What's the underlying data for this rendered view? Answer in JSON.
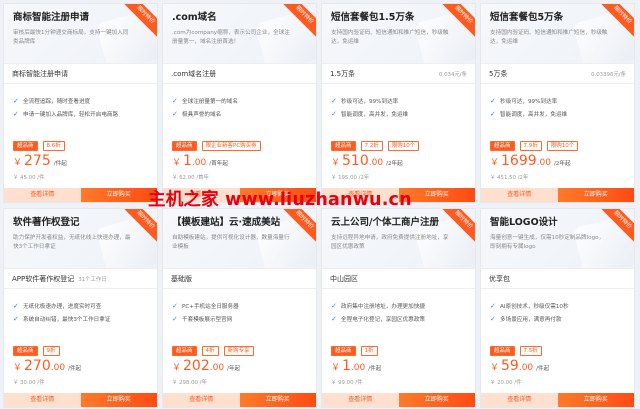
{
  "ribbon_label": "限时特价",
  "buttons": {
    "detail": "查看详情",
    "buy": "立即购买"
  },
  "watermark": "主机之家 www.liuzhanwu.cn",
  "cards": [
    {
      "title": "商标智能注册申请",
      "desc": "审核后最快1分钟递交商标局，支持一键加入同类品牌库",
      "spec": "商标智能注册申请",
      "spec_note": "",
      "spec_sub": "",
      "features": [
        "全流程追踪，随时查看进度",
        "申请一键加入品牌库，轻松开启电商路"
      ],
      "tags": [
        {
          "t": "超品商",
          "fill": true
        },
        {
          "t": "8.6折",
          "fill": false
        }
      ],
      "price": "275",
      "unit": "/件起",
      "orig": "￥ 45.00 /件"
    },
    {
      "title": ".com域名",
      "desc": ".com为company缩称，表示公司企业，全球注册量第一，域名注册首选！",
      "spec": ".com域名注册",
      "spec_note": "",
      "spec_sub": "",
      "features": [
        "全球注册量第一的域名",
        "极具声誉的域名"
      ],
      "tags": [
        {
          "t": "超品商",
          "fill": true
        },
        {
          "t": "限企业新客PC购买券",
          "fill": false
        }
      ],
      "price": "1",
      "price_dec": ".00",
      "unit": "/首年起",
      "orig": "￥ 62.00 /首年"
    },
    {
      "title": "短信套餐包1.5万条",
      "desc": "支持国内验证码、短信通知和推广短信，秒级触达，免运维",
      "spec": "1.5万条",
      "spec_note": "",
      "spec_sub": "0.034元/条",
      "features": [
        "秒级可达，99%到达率",
        "智能调度，高并发，免运维"
      ],
      "tags": [
        {
          "t": "超品商",
          "fill": true
        },
        {
          "t": "7.2折",
          "fill": false
        },
        {
          "t": "限购10个",
          "fill": false
        }
      ],
      "price": "510",
      "price_dec": ".00",
      "unit": "/2年起",
      "orig": "￥ 195.00 /2年"
    },
    {
      "title": "短信套餐包5万条",
      "desc": "支持国内验证码、短信通知和推广短信，秒级触达，免运维",
      "spec": "5万条",
      "spec_note": "",
      "spec_sub": "0.03396元/条",
      "features": [
        "秒级可达，99%到达率",
        "智能调度，高并发，免运维"
      ],
      "tags": [
        {
          "t": "超品商",
          "fill": true
        },
        {
          "t": "7.9折",
          "fill": false
        },
        {
          "t": "限购10个",
          "fill": false
        }
      ],
      "price": "1699",
      "price_dec": ".00",
      "unit": "/2年起",
      "orig": "￥ 451.50 /2年"
    },
    {
      "title": "软件著作权登记",
      "desc": "助力保护开发者权益，无纸化线上快速办理，最快3个工作日拿证",
      "spec": "APP软件著作权登记",
      "spec_note": "31个工作日",
      "spec_sub": "",
      "features": [
        "无纸化极速办理，进度实时可查",
        "系统自动纠错，最快3个工作日拿证"
      ],
      "tags": [
        {
          "t": "超品商",
          "fill": true
        },
        {
          "t": "9折",
          "fill": false
        }
      ],
      "price": "270",
      "price_dec": ".00",
      "unit": "/件起",
      "orig": "￥ 30.00 /件"
    },
    {
      "title": "【模板建站】云·速成美站",
      "desc": "自助模板建站，提供可视化设计器，数量海量行业模板",
      "spec": "基础版",
      "spec_note": "",
      "spec_sub": "",
      "features": [
        "PC+手机站全日服务器",
        "千套模板展示型官网"
      ],
      "tags": [
        {
          "t": "超品商",
          "fill": true
        },
        {
          "t": "4折",
          "fill": false
        },
        {
          "t": "新购专享",
          "fill": false
        }
      ],
      "price": "202",
      "price_dec": ".00",
      "unit": "/年起",
      "orig": "￥ 298.00 /年"
    },
    {
      "title": "云上公司/个体工商户注册",
      "desc": "支持远程异地申请，政府免费提供注册地址，享园区优惠政策",
      "spec": "中山园区",
      "spec_note": "",
      "spec_sub": "",
      "features": [
        "政府集中注册地址，办理更加快捷",
        "全程电子化登记，享园区优惠政策"
      ],
      "tags": [
        {
          "t": "超品商",
          "fill": true
        },
        {
          "t": "1折",
          "fill": false
        }
      ],
      "price": "1",
      "price_dec": ".00",
      "unit": "/件起",
      "orig": "￥ 99.00 /件"
    },
    {
      "title": "智能LOGO设计",
      "desc": "海量创意一键生成，仅需10秒定制品牌logo，即刻拥有专属logo",
      "spec": "优享包",
      "spec_note": "",
      "spec_sub": "",
      "features": [
        "AI原创技术，秒级仅需10秒",
        "多场景应用，满意再付款"
      ],
      "tags": [
        {
          "t": "超品商",
          "fill": true
        },
        {
          "t": "7.5折",
          "fill": false
        }
      ],
      "price": "59",
      "price_dec": ".00",
      "unit": "/件起",
      "orig": "￥ 20.00 /件"
    }
  ]
}
